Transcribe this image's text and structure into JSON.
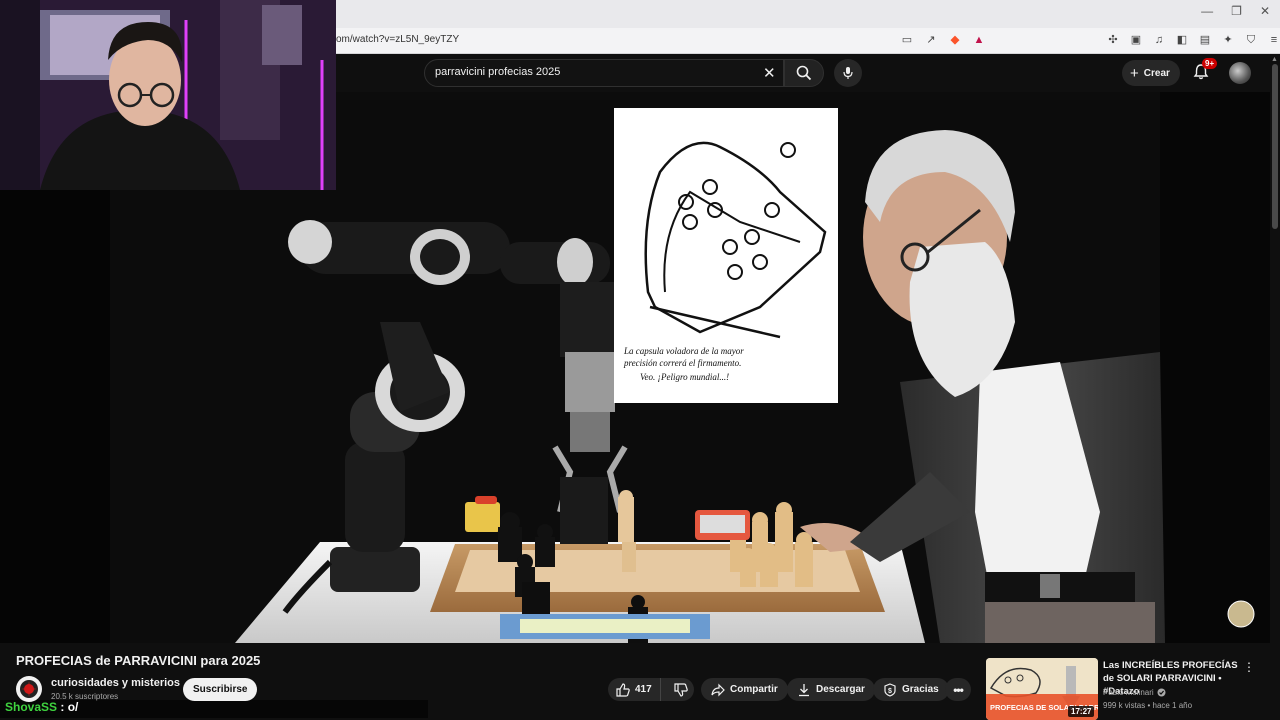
{
  "browser": {
    "url": "om/watch?v=zL5N_9eyTZY",
    "window_controls": [
      "—",
      "❐",
      "✕"
    ]
  },
  "masthead": {
    "search_query": "parravicini profecias 2025",
    "create_label": "Crear",
    "notifications_badge": "9+"
  },
  "video": {
    "sketch_caption_lines": [
      "La capsula voladora de la mayor",
      "precisión correrá el firmamento.",
      "Veo. ¡Peligro mundial...!"
    ]
  },
  "stream_chat": {
    "user": "ShovaSS",
    "message": ": o/"
  },
  "watch": {
    "title": "PROFECIAS de PARRAVICINI para 2025",
    "channel_name": "curiosidades y misterios",
    "subscribers": "20.5 k suscriptores",
    "subscribe_label": "Suscribirse",
    "likes": "417",
    "share_label": "Compartir",
    "download_label": "Descargar",
    "thanks_label": "Gracias"
  },
  "recommendation": {
    "title": "Las INCREÍBLES PROFECÍAS de SOLARI PARRAVICINI • #Datazo",
    "channel": "Pablo Molinari",
    "meta": "999 k vistas • hace 1 año",
    "duration": "17:27",
    "thumb_text": "PROFECIAS DE SOLARI PARRAVICINI"
  },
  "colors": {
    "accent_red": "#cc0000",
    "chat_username": "#3fd33f",
    "background": "#0f0f0f"
  }
}
